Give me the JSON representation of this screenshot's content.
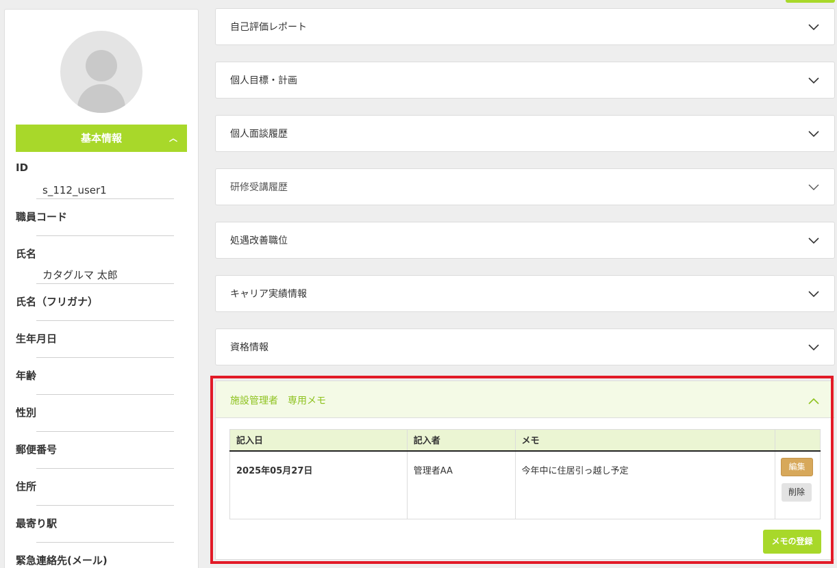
{
  "profile": {
    "section_title": "基本情報",
    "fields": [
      {
        "label": "ID",
        "value": "s_112_user1"
      },
      {
        "label": "職員コード",
        "value": ""
      },
      {
        "label": "氏名",
        "value": "カタグルマ 太郎"
      },
      {
        "label": "氏名（フリガナ）",
        "value": ""
      },
      {
        "label": "生年月日",
        "value": ""
      },
      {
        "label": "年齢",
        "value": ""
      },
      {
        "label": "性別",
        "value": ""
      },
      {
        "label": "郵便番号",
        "value": ""
      },
      {
        "label": "住所",
        "value": ""
      },
      {
        "label": "最寄り駅",
        "value": ""
      },
      {
        "label": "緊急連絡先(メール)",
        "value": ""
      }
    ]
  },
  "accordions": [
    {
      "label": "自己評価レポート"
    },
    {
      "label": "個人目標・計画"
    },
    {
      "label": "個人面談履歴"
    },
    {
      "label": "研修受講履歴"
    },
    {
      "label": "処遇改善職位"
    },
    {
      "label": "キャリア実績情報"
    },
    {
      "label": "資格情報"
    }
  ],
  "memo": {
    "title": "施設管理者　専用メモ",
    "columns": [
      "記入日",
      "記入者",
      "メモ",
      ""
    ],
    "rows": [
      {
        "date": "2025年05月27日",
        "author": "管理者AA",
        "memo": "今年中に住居引っ越し予定",
        "edit_label": "編集",
        "delete_label": "削除"
      }
    ],
    "register_label": "メモの登録"
  },
  "colors": {
    "accent": "#a8d82a",
    "highlight": "#e21a27",
    "edit": "#d7a85a"
  }
}
